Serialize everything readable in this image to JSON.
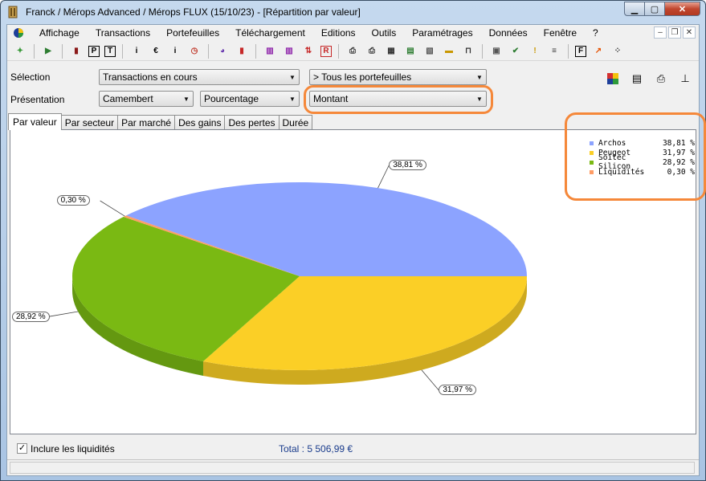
{
  "window": {
    "title": "Franck / Mérops Advanced / Mérops FLUX (15/10/23) - [Répartition par valeur]"
  },
  "menu": [
    "Affichage",
    "Transactions",
    "Portefeuilles",
    "Téléchargement",
    "Editions",
    "Outils",
    "Paramétrages",
    "Données",
    "Fenêtre",
    "?"
  ],
  "toolbar_icons": [
    {
      "name": "wizard-icon",
      "glyph": "✦",
      "color": "#3a9a3a"
    },
    {
      "name": "run-icon",
      "glyph": "▶",
      "color": "#2e7d32"
    },
    {
      "name": "book-icon",
      "glyph": "▮",
      "color": "#8b1a1a"
    },
    {
      "name": "p-icon",
      "glyph": "P",
      "color": "#000"
    },
    {
      "name": "t-icon",
      "glyph": "T",
      "color": "#000"
    },
    {
      "name": "info-icon",
      "glyph": "i",
      "color": "#000"
    },
    {
      "name": "euro-icon",
      "glyph": "€",
      "color": "#000"
    },
    {
      "name": "detail-icon",
      "glyph": "i",
      "color": "#000"
    },
    {
      "name": "clock-icon",
      "glyph": "◷",
      "color": "#c0392b"
    },
    {
      "name": "pie-icon",
      "glyph": "◕",
      "color": "#6a3ab0"
    },
    {
      "name": "bars-icon",
      "glyph": "▮",
      "color": "#c62828"
    },
    {
      "name": "stock-icon",
      "glyph": "▥",
      "color": "#8e24aa"
    },
    {
      "name": "stock2-icon",
      "glyph": "▥",
      "color": "#8e24aa"
    },
    {
      "name": "updown-icon",
      "glyph": "⇅",
      "color": "#c62828"
    },
    {
      "name": "r-icon",
      "glyph": "R",
      "color": "#c62828"
    },
    {
      "name": "print-icon",
      "glyph": "⎙",
      "color": "#333"
    },
    {
      "name": "print2-icon",
      "glyph": "⎙",
      "color": "#333"
    },
    {
      "name": "table-icon",
      "glyph": "▦",
      "color": "#333"
    },
    {
      "name": "grid-icon",
      "glyph": "▤",
      "color": "#2e7d32"
    },
    {
      "name": "image-icon",
      "glyph": "▧",
      "color": "#555"
    },
    {
      "name": "ruler-icon",
      "glyph": "▬",
      "color": "#c99700"
    },
    {
      "name": "scale-icon",
      "glyph": "⊓",
      "color": "#333"
    },
    {
      "name": "calc-icon",
      "glyph": "▣",
      "color": "#555"
    },
    {
      "name": "check-icon",
      "glyph": "✔",
      "color": "#2e7d32"
    },
    {
      "name": "alert-icon",
      "glyph": "!",
      "color": "#c99700"
    },
    {
      "name": "list-icon",
      "glyph": "≡",
      "color": "#333"
    },
    {
      "name": "f-icon",
      "glyph": "F",
      "color": "#000"
    },
    {
      "name": "export-icon",
      "glyph": "↗",
      "color": "#e65100"
    },
    {
      "name": "dots-icon",
      "glyph": "⁘",
      "color": "#333"
    }
  ],
  "selection": {
    "label": "Sélection",
    "transactions": "Transactions en cours",
    "portefeuilles": "> Tous les portefeuilles"
  },
  "presentation": {
    "label": "Présentation",
    "type": "Camembert",
    "mode": "Pourcentage",
    "value": "Montant"
  },
  "tabs": [
    "Par valeur",
    "Par secteur",
    "Par marché",
    "Des gains",
    "Des pertes",
    "Durée"
  ],
  "active_tab": 0,
  "chart_data": {
    "type": "pie",
    "categories": [
      "Archos",
      "Peugeot",
      "Soitec Silicon",
      "Liquidités"
    ],
    "values": [
      38.81,
      31.97,
      28.92,
      0.3
    ],
    "labels": [
      "38,81 %",
      "31,97 %",
      "28,92 %",
      "0,30 %"
    ],
    "colors": [
      "#8ca3ff",
      "#fbcf26",
      "#7ab913",
      "#ff9d66"
    ],
    "legend_position": "top-right"
  },
  "legend": [
    {
      "name": "Archos",
      "value": "38,81 %",
      "color": "#8ca3ff"
    },
    {
      "name": "Peugeot",
      "value": "31,97 %",
      "color": "#fbcf26"
    },
    {
      "name": "Soitec Silicon",
      "value": "28,92 %",
      "color": "#7ab913"
    },
    {
      "name": "Liquidités",
      "value": "0,30 %",
      "color": "#ff9d66"
    }
  ],
  "footer": {
    "include_cash_label": "Inclure les liquidités",
    "include_cash_checked": true,
    "total": "Total : 5 506,99 €"
  }
}
